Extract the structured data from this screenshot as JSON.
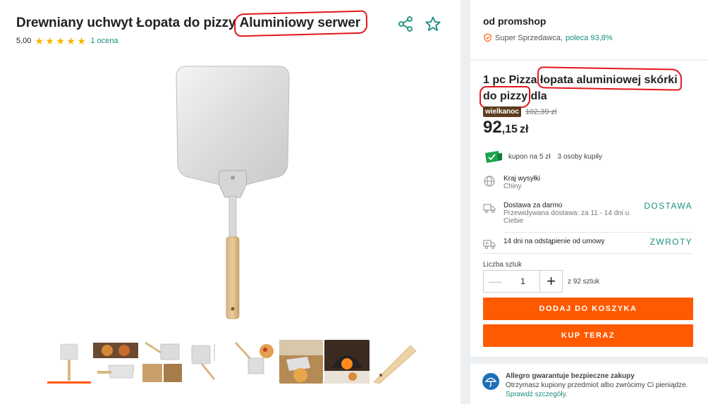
{
  "product": {
    "title_plain": "Drewniany uchwyt Łopata do pizzy ",
    "title_highlight": "Aluminiowy serwer",
    "rating_value": "5,00",
    "rating_count": "1 ocena",
    "stars": 5
  },
  "thumbnails": [
    "pizza-peel-white",
    "pizza-on-peel-table",
    "peel-with-tiles",
    "peel-dimensions",
    "peel-with-pizza",
    "pizza-oven-board",
    "pizza-oven-fire",
    "wooden-handle-closeup"
  ],
  "seller": {
    "name": "od promshop",
    "badge": "Super Sprzedawca,",
    "recommend": "poleca 93,8%"
  },
  "offer": {
    "title_a": "1 pc Pizza ",
    "title_hl_a": "łopata aluminiowej skórki",
    "title_hl_b": "do pizzy",
    "title_b": " dla",
    "promo_badge": "wielkanoc",
    "old_price": "102,39 zł",
    "price_int": "92",
    "price_dec": ",15",
    "currency": "zł",
    "coupon": "kupon na 5 zł",
    "buyers": "3 osoby kupiły",
    "ship_country_label": "Kraj wysyłki",
    "ship_country": "Chiny",
    "delivery_title": "Dostawa za darmo",
    "delivery_sub": "Przewidywana dostawa: za 11 - 14 dni u Ciebie",
    "delivery_link": "DOSTAWA",
    "returns_title": "14 dni na odstąpienie od umowy",
    "returns_link": "ZWROTY",
    "qty_label": "Liczba sztuk",
    "qty_value": "1",
    "qty_of": "z 92 sztuk",
    "add_to_cart": "DODAJ DO KOSZYKA",
    "buy_now": "KUP TERAZ"
  },
  "guarantee": {
    "title": "Allegro gwarantuje bezpieczne zakupy",
    "text": "Otrzymasz kupiony przedmiot albo zwrócimy Ci pieniądze.",
    "link": "Sprawdź szczegóły."
  },
  "colors": {
    "accent": "#ff5a00",
    "link": "#1a8f7e",
    "star": "#f7b500",
    "highlight": "#e2161c"
  }
}
